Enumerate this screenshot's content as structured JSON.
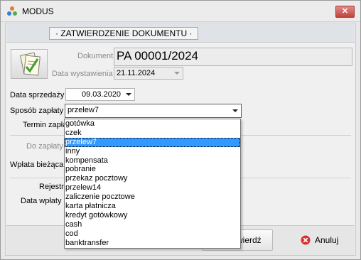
{
  "window": {
    "title": "MODUS",
    "close_glyph": "✕"
  },
  "header": {
    "label": "ZATWIERDZENIE DOKUMENTU"
  },
  "document": {
    "label": "Dokument",
    "value": "PA 00001/2024",
    "issue_date_label": "Data wystawienia",
    "issue_date_value": "21.11.2024"
  },
  "form": {
    "sale_date_label": "Data sprzedaży",
    "sale_date_value": "09.03.2020",
    "payment_method_label": "Sposób zapłaty",
    "payment_method_value": "przelew7",
    "payment_term_label": "Termin zapłaty",
    "to_pay_label": "Do zapłaty",
    "current_payment_label": "Wpłata bieżąca",
    "register_label": "Rejestr",
    "payment_date_label": "Data wpłaty"
  },
  "payment_options": [
    {
      "label": "gotówka",
      "selected": false
    },
    {
      "label": "czek",
      "selected": false
    },
    {
      "label": "przelew7",
      "selected": true
    },
    {
      "label": "inny",
      "selected": false
    },
    {
      "label": "kompensata",
      "selected": false
    },
    {
      "label": "pobranie",
      "selected": false
    },
    {
      "label": "przekaz pocztowy",
      "selected": false
    },
    {
      "label": "przelew14",
      "selected": false
    },
    {
      "label": "zaliczenie pocztowe",
      "selected": false
    },
    {
      "label": "karta płatnicza",
      "selected": false
    },
    {
      "label": "kredyt gotówkowy",
      "selected": false
    },
    {
      "label": "cash",
      "selected": false
    },
    {
      "label": "cod",
      "selected": false
    },
    {
      "label": "banktransfer",
      "selected": false
    }
  ],
  "buttons": {
    "confirm_label": "wierdź",
    "cancel_label": "Anuluj"
  },
  "colors": {
    "selection": "#3399ff",
    "cancel_icon": "#d9322b",
    "close_button": "#c1443d"
  }
}
